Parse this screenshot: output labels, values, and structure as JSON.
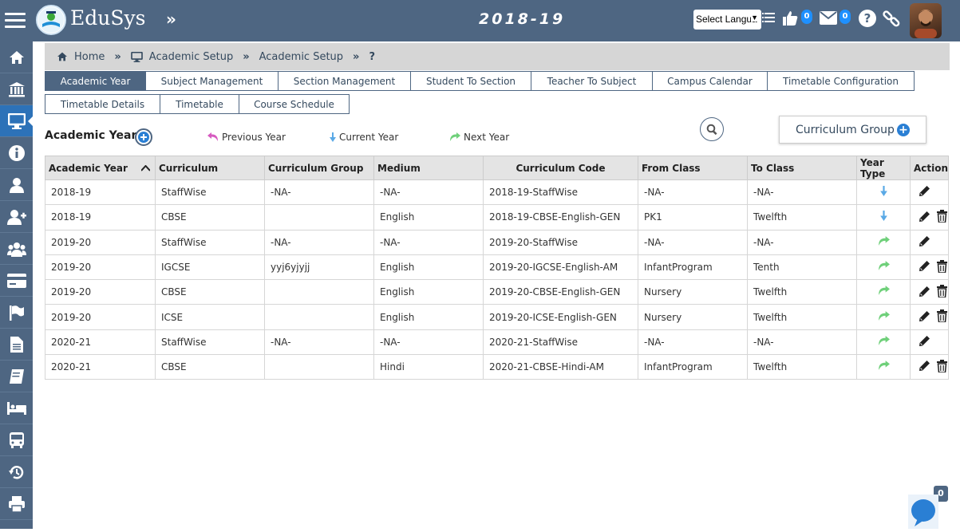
{
  "app": {
    "brand": "EduSys",
    "session_year": "2018-19"
  },
  "header": {
    "language_select": "Select Langua",
    "likes_count": "0",
    "messages_count": "0"
  },
  "breadcrumb": [
    "Home",
    "Academic Setup",
    "Academic Setup",
    "?"
  ],
  "tabs_row1": [
    {
      "label": "Academic Year",
      "active": true
    },
    {
      "label": "Subject Management"
    },
    {
      "label": "Section Management"
    },
    {
      "label": "Student To Section"
    },
    {
      "label": "Teacher To Subject"
    },
    {
      "label": "Campus Calendar"
    },
    {
      "label": "Timetable Configuration"
    }
  ],
  "tabs_row2": [
    {
      "label": "Timetable Details"
    },
    {
      "label": "Timetable"
    },
    {
      "label": "Course Schedule"
    }
  ],
  "toolbar": {
    "title": "Academic Year",
    "legend": {
      "previous": "Previous Year",
      "current": "Current Year",
      "next": "Next Year"
    },
    "curriculum_group_button": "Curriculum Group"
  },
  "table": {
    "columns": [
      "Academic Year",
      "Curriculum",
      "Curriculum Group",
      "Medium",
      "Curriculum Code",
      "From Class",
      "To Class",
      "Year Type",
      "Action"
    ],
    "rows": [
      {
        "year": "2018-19",
        "curriculum": "StaffWise",
        "group": "-NA-",
        "medium": "-NA-",
        "code": "2018-19-StaffWise",
        "from": "-NA-",
        "to": "-NA-",
        "type": "current",
        "delete": false
      },
      {
        "year": "2018-19",
        "curriculum": "CBSE",
        "group": "",
        "medium": "English",
        "code": "2018-19-CBSE-English-GEN",
        "from": "PK1",
        "to": "Twelfth",
        "type": "current",
        "delete": true
      },
      {
        "year": "2019-20",
        "curriculum": "StaffWise",
        "group": "-NA-",
        "medium": "-NA-",
        "code": "2019-20-StaffWise",
        "from": "-NA-",
        "to": "-NA-",
        "type": "next",
        "delete": false
      },
      {
        "year": "2019-20",
        "curriculum": "IGCSE",
        "group": "yyj6yjyjj",
        "medium": "English",
        "code": "2019-20-IGCSE-English-AM",
        "from": "InfantProgram",
        "to": "Tenth",
        "type": "next",
        "delete": true
      },
      {
        "year": "2019-20",
        "curriculum": "CBSE",
        "group": "",
        "medium": "English",
        "code": "2019-20-CBSE-English-GEN",
        "from": "Nursery",
        "to": "Twelfth",
        "type": "next",
        "delete": true
      },
      {
        "year": "2019-20",
        "curriculum": "ICSE",
        "group": "",
        "medium": "English",
        "code": "2019-20-ICSE-English-GEN",
        "from": "Nursery",
        "to": "Twelfth",
        "type": "next",
        "delete": true
      },
      {
        "year": "2020-21",
        "curriculum": "StaffWise",
        "group": "-NA-",
        "medium": "-NA-",
        "code": "2020-21-StaffWise",
        "from": "-NA-",
        "to": "-NA-",
        "type": "next",
        "delete": false
      },
      {
        "year": "2020-21",
        "curriculum": "CBSE",
        "group": "",
        "medium": "Hindi",
        "code": "2020-21-CBSE-Hindi-AM",
        "from": "InfantProgram",
        "to": "Twelfth",
        "type": "next",
        "delete": true
      }
    ]
  },
  "chat": {
    "unread": "0"
  },
  "colors": {
    "header": "#4e6682",
    "accent": "#2a7fd4",
    "current": "#5aa9e6",
    "next": "#6fd07a",
    "previous": "#d65ac0"
  }
}
